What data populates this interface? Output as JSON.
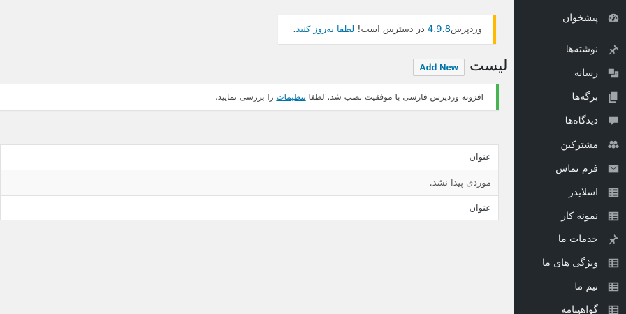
{
  "sidebar": {
    "items": [
      {
        "label": "پیشخوان",
        "icon": "dashboard-icon"
      },
      {
        "label": "نوشته‌ها",
        "icon": "pin-icon"
      },
      {
        "label": "رسانه",
        "icon": "media-icon"
      },
      {
        "label": "برگه‌ها",
        "icon": "pages-icon"
      },
      {
        "label": "دیدگاه‌ها",
        "icon": "comments-icon"
      },
      {
        "label": "مشترکین",
        "icon": "groups-icon"
      },
      {
        "label": "فرم تماس",
        "icon": "email-icon"
      },
      {
        "label": "اسلایدر",
        "icon": "list-view-icon"
      },
      {
        "label": "نمونه کار",
        "icon": "list-view-icon"
      },
      {
        "label": "خدمات ما",
        "icon": "pin-icon"
      },
      {
        "label": "ویژگی های ما",
        "icon": "list-view-icon"
      },
      {
        "label": "تیم ما",
        "icon": "list-view-icon"
      },
      {
        "label": "گواهینامه",
        "icon": "list-view-icon"
      }
    ]
  },
  "update_nag": {
    "prefix": "وردپرس ",
    "version_link": "4.9.8",
    "middle": " در دسترس است! ",
    "update_link": "لطفا به‌روز کنید",
    "suffix": "."
  },
  "heading": {
    "title": "لیست",
    "add_new": "Add New"
  },
  "notice": {
    "prefix": "افزونه وردپرس فارسی با موفقیت نصب شد. لطفا ",
    "link": "تنظیمات",
    "suffix": " را بررسی نمایید."
  },
  "table": {
    "header": "عنوان",
    "empty_message": "موردی پیدا نشد.",
    "footer": "عنوان"
  },
  "colors": {
    "sidebar_bg": "#23282d",
    "page_bg": "#f1f1f1",
    "link": "#0073aa",
    "update_accent": "#ffb900",
    "success_accent": "#46b450"
  }
}
